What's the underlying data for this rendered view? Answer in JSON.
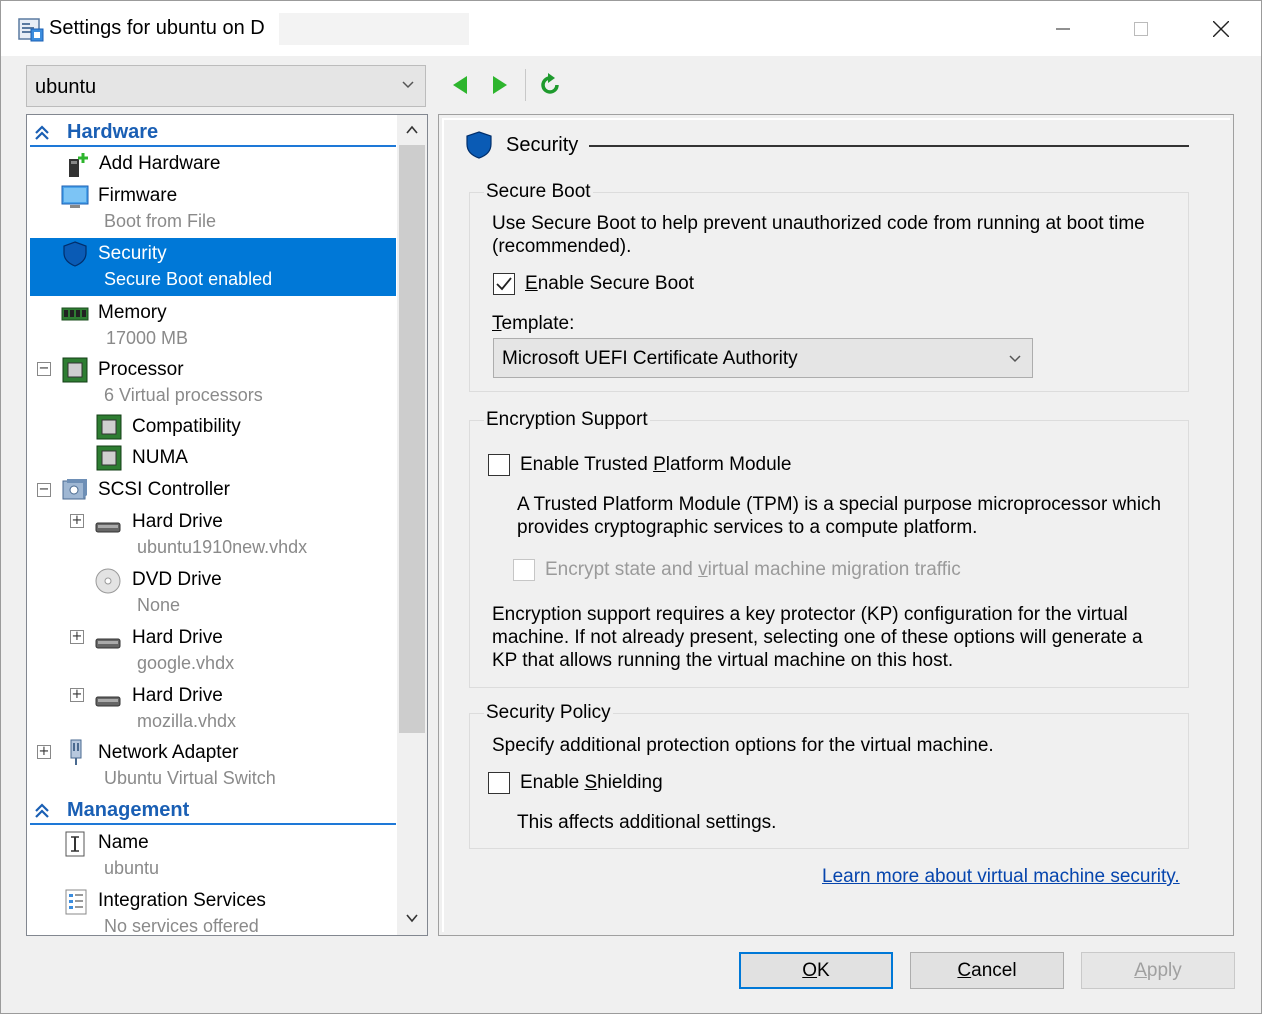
{
  "window": {
    "title": "Settings for ubuntu on D",
    "minimize": "—",
    "maximize": "☐",
    "close": "✕"
  },
  "vm_selector": {
    "value": "ubuntu"
  },
  "toolbar": {
    "back": "previous-icon",
    "forward": "next-icon",
    "refresh": "refresh-icon"
  },
  "tree": {
    "hardware_header": "Hardware",
    "management_header": "Management",
    "items": {
      "add_hardware": {
        "label": "Add Hardware"
      },
      "firmware": {
        "label": "Firmware",
        "sub": "Boot from File"
      },
      "security": {
        "label": "Security",
        "sub": "Secure Boot enabled"
      },
      "memory": {
        "label": "Memory",
        "sub": "17000 MB"
      },
      "processor": {
        "label": "Processor",
        "sub": "6 Virtual processors"
      },
      "compatibility": {
        "label": "Compatibility"
      },
      "numa": {
        "label": "NUMA"
      },
      "scsi": {
        "label": "SCSI Controller"
      },
      "hd1": {
        "label": "Hard Drive",
        "sub": "ubuntu1910new.vhdx"
      },
      "dvd": {
        "label": "DVD Drive",
        "sub": "None"
      },
      "hd2": {
        "label": "Hard Drive",
        "sub": "google.vhdx"
      },
      "hd3": {
        "label": "Hard Drive",
        "sub": "mozilla.vhdx"
      },
      "network": {
        "label": "Network Adapter",
        "sub": "Ubuntu Virtual Switch"
      },
      "name": {
        "label": "Name",
        "sub": "ubuntu"
      },
      "integration": {
        "label": "Integration Services",
        "sub": "No services offered"
      }
    },
    "expander_plus": "+",
    "expander_minus": "−"
  },
  "panel": {
    "title": "Security",
    "secure_boot": {
      "title": "Secure Boot",
      "desc_line1": "Use Secure Boot to help prevent unauthorized code from running at boot time",
      "desc_line2": "(recommended).",
      "enable_label_pre": "",
      "enable_label_u": "E",
      "enable_label_rest": "nable Secure Boot",
      "enable_checked": true,
      "template_label_u": "T",
      "template_label_rest": "emplate:",
      "template_value": "Microsoft UEFI Certificate Authority"
    },
    "encryption": {
      "title": "Encryption Support",
      "tpm_label_pre": "Enable Trusted ",
      "tpm_label_u": "P",
      "tpm_label_rest": "latform Module",
      "tpm_desc_line1": "A Trusted Platform Module (TPM) is a special purpose microprocessor which",
      "tpm_desc_line2": "provides cryptographic services to a compute platform.",
      "encrypt_label_pre": "Encrypt state and ",
      "encrypt_label_u": "v",
      "encrypt_label_rest": "irtual machine migration traffic",
      "kp_line1": "Encryption support requires a key protector (KP) configuration for the virtual",
      "kp_line2": "machine. If not already present, selecting one of these options will generate a",
      "kp_line3": "KP that allows running the virtual machine on this host."
    },
    "policy": {
      "title": "Security Policy",
      "desc": "Specify additional protection options for the virtual machine.",
      "shield_label_pre": "Enable ",
      "shield_label_u": "S",
      "shield_label_rest": "hielding",
      "note": "This affects additional settings."
    },
    "learn_more": "Learn more about virtual machine security."
  },
  "buttons": {
    "ok_u": "O",
    "ok_rest": "K",
    "cancel_u": "C",
    "cancel_rest": "ancel",
    "apply_u": "A",
    "apply_rest": "pply"
  }
}
